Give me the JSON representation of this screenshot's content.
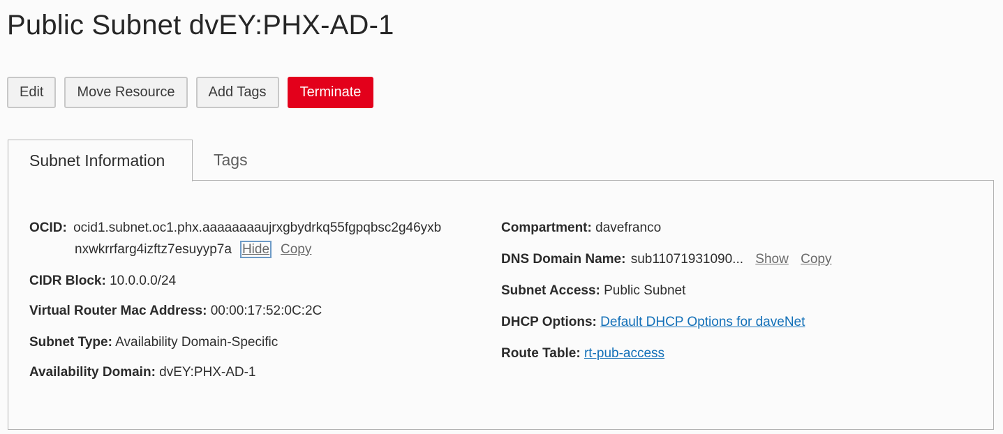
{
  "page": {
    "title": "Public Subnet dvEY:PHX-AD-1"
  },
  "actions": {
    "edit": "Edit",
    "move_resource": "Move Resource",
    "add_tags": "Add Tags",
    "terminate": "Terminate"
  },
  "tabs": [
    {
      "label": "Subnet Information",
      "active": true
    },
    {
      "label": "Tags",
      "active": false
    }
  ],
  "info": {
    "ocid": {
      "label": "OCID:",
      "value_line1": "ocid1.subnet.oc1.phx.aaaaaaaaujrxgbydrkq55fgpqbsc2g46yxb",
      "value_line2": "nxwkrrfarg4izftz7esuyyp7a",
      "hide_link": "Hide",
      "copy_link": "Copy"
    },
    "cidr_block": {
      "label": "CIDR Block:",
      "value": "10.0.0.0/24"
    },
    "virtual_router_mac": {
      "label": "Virtual Router Mac Address:",
      "value": "00:00:17:52:0C:2C"
    },
    "subnet_type": {
      "label": "Subnet Type:",
      "value": "Availability Domain-Specific"
    },
    "availability_domain": {
      "label": "Availability Domain:",
      "value": "dvEY:PHX-AD-1"
    },
    "compartment": {
      "label": "Compartment:",
      "value": "davefranco"
    },
    "dns_domain_name": {
      "label": "DNS Domain Name:",
      "value": "sub11071931090...",
      "show_link": "Show",
      "copy_link": "Copy"
    },
    "subnet_access": {
      "label": "Subnet Access:",
      "value": "Public Subnet"
    },
    "dhcp_options": {
      "label": "DHCP Options:",
      "value": "Default DHCP Options for daveNet"
    },
    "route_table": {
      "label": "Route Table:",
      "value": "rt-pub-access"
    }
  },
  "colors": {
    "danger": "#e3001b",
    "link": "#1370b8",
    "focus_outline": "#6d9ac6"
  }
}
